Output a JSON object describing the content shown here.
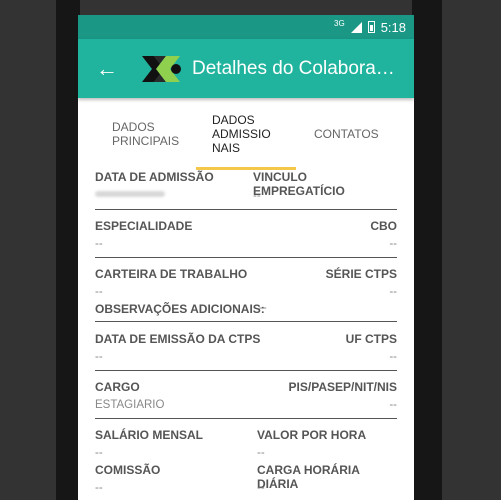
{
  "status_bar": {
    "network": "3G",
    "time": "5:18"
  },
  "app_bar": {
    "title": "Detalhes do Colabora…",
    "back_label": "←"
  },
  "tabs": [
    {
      "label": "DADOS PRINCIPAIS"
    },
    {
      "label": "DADOS ADMISSIONAIS"
    },
    {
      "label": "CONTATOS"
    }
  ],
  "tab_lines": {
    "tab1": [
      "DADOS",
      "PRINCIPAIS"
    ],
    "tab2": [
      "DADOS",
      "ADMISSIO",
      "NAIS"
    ],
    "tab3": [
      "CONTATOS"
    ]
  },
  "fields": {
    "data_admissao": {
      "label": "DATA DE ADMISSÃO",
      "value": ""
    },
    "vinculo": {
      "label": "VINCULO EMPREGATÍCIO",
      "value": "--"
    },
    "especialidade": {
      "label": "ESPECIALIDADE",
      "value": "--"
    },
    "cbo": {
      "label": "CBO",
      "value": "--"
    },
    "carteira": {
      "label": "CARTEIRA DE TRABALHO",
      "value": "--"
    },
    "serie_ctps": {
      "label": "SÉRIE CTPS",
      "value": "--"
    },
    "observacoes": {
      "label": "OBSERVAÇÕES ADICIONAIS:",
      "value": "--"
    },
    "data_emissao": {
      "label": "DATA DE EMISSÃO DA CTPS",
      "value": "--"
    },
    "uf_ctps": {
      "label": "UF CTPS",
      "value": "--"
    },
    "cargo": {
      "label": "CARGO",
      "value": "ESTAGIARIO"
    },
    "pis": {
      "label": "PIS/PASEP/NIT/NIS",
      "value": "--"
    },
    "salario": {
      "label": "SALÁRIO MENSAL",
      "value": "--"
    },
    "valor_hora": {
      "label": "VALOR POR HORA",
      "value": "--"
    },
    "comissao": {
      "label": "COMISSÃO",
      "value": "--"
    },
    "carga_horaria": {
      "label": "CARGA HORÁRIA DIÁRIA",
      "value": "--"
    }
  },
  "colors": {
    "primary": "#20b39d",
    "primary_dark": "#1a9785",
    "accent": "#f4c74b"
  },
  "icons": {
    "back": "arrow-left-icon",
    "logo": "app-logo-icon"
  }
}
